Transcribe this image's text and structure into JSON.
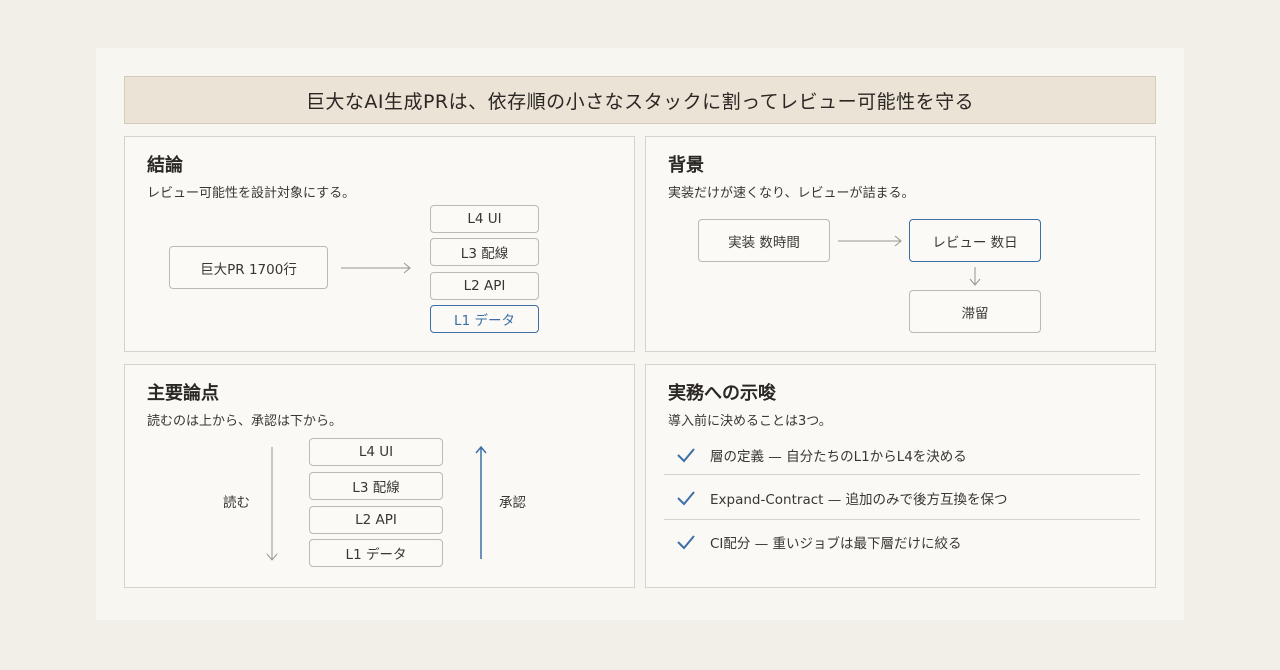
{
  "title": "巨大なAI生成PRは、依存順の小さなスタックに割ってレビュー可能性を守る",
  "conclusion": {
    "heading": "結論",
    "subtitle": "レビュー可能性を設計対象にする。",
    "big_pr": "巨大PR 1700行",
    "stack": [
      "L4 UI",
      "L3 配線",
      "L2 API",
      "L1 データ"
    ]
  },
  "background": {
    "heading": "背景",
    "subtitle": "実装だけが速くなり、レビューが詰まる。",
    "impl": "実装 数時間",
    "review": "レビュー 数日",
    "stall": "滞留"
  },
  "points": {
    "heading": "主要論点",
    "subtitle": "読むのは上から、承認は下から。",
    "read_label": "読む",
    "approve_label": "承認",
    "stack": [
      "L4 UI",
      "L3 配線",
      "L2 API",
      "L1 データ"
    ]
  },
  "implications": {
    "heading": "実務への示唆",
    "subtitle": "導入前に決めることは3つ。",
    "items": [
      "層の定義 — 自分たちのL1からL4を決める",
      "Expand-Contract — 追加のみで後方互換を保つ",
      "CI配分 — 重いジョブは最下層だけに絞る"
    ]
  },
  "colors": {
    "accent": "#3d6ea6",
    "title_bg": "#ebe3d5",
    "panel_border": "#d8d3ca"
  }
}
